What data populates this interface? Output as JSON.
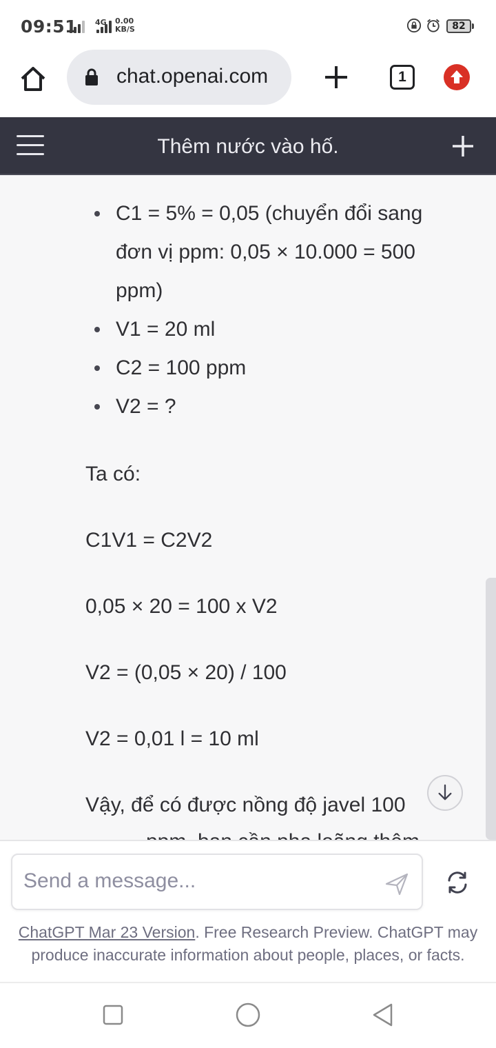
{
  "status_bar": {
    "time": "09:51",
    "network_type": "4G",
    "speed_value": "0.00",
    "speed_unit": "KB/S",
    "battery_level": "82"
  },
  "browser": {
    "url": "chat.openai.com",
    "tab_count": "1"
  },
  "chat_header": {
    "title": "Thêm nước vào hố."
  },
  "message": {
    "bullets": [
      "C1 = 5% = 0,05 (chuyển đổi sang đơn vị ppm: 0,05 × 10.000 = 500 ppm)",
      "V1 = 20 ml",
      "C2 = 100 ppm",
      "V2 = ?"
    ],
    "paragraphs": [
      "Ta có:",
      "C1V1 = C2V2",
      "0,05 × 20 = 100 x V2",
      "V2 = (0,05 × 20) / 100",
      "V2 = 0,01 l = 10 ml",
      "Vậy, để có được nồng độ javel 100"
    ],
    "cut_off_text": "ppm, bạn cần pha loãng thêm"
  },
  "composer": {
    "placeholder": "Send a message..."
  },
  "footer": {
    "version_link": "ChatGPT Mar 23 Version",
    "disclaimer": ". Free Research Preview. ChatGPT may produce inaccurate information about people, places, or facts."
  },
  "icons": {
    "home": "home-icon",
    "lock": "lock-icon",
    "new_tab": "plus-icon",
    "tabs": "tab-switcher-icon",
    "update": "update-arrow-icon",
    "menu": "hamburger-icon",
    "new_chat": "plus-icon",
    "send": "send-icon",
    "regenerate": "refresh-icon",
    "scroll_down": "arrow-down-icon"
  },
  "colors": {
    "header_bg": "#343541",
    "content_bg": "#f7f7f8",
    "update_badge": "#d93025"
  }
}
